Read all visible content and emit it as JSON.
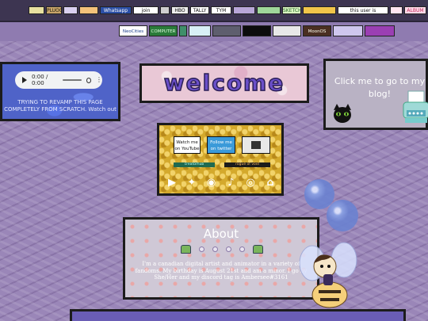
{
  "stamps": [
    {
      "label": "",
      "bg": "#e8e0a0",
      "fg": "#333"
    },
    {
      "label": "PLUOO",
      "bg": "#c9a46a",
      "fg": "#221"
    },
    {
      "label": "",
      "bg": "#d9d0f0",
      "fg": "#333"
    },
    {
      "label": "",
      "bg": "#f4c27a",
      "fg": "#333"
    },
    {
      "label": "Whatsapp",
      "bg": "#2b4fa6",
      "fg": "#fff"
    },
    {
      "label": "join",
      "bg": "#ffffff",
      "fg": "#111"
    },
    {
      "label": "",
      "bg": "#cfcfcf",
      "fg": "#333"
    },
    {
      "label": "HBO",
      "bg": "#eeeeee",
      "fg": "#111"
    },
    {
      "label": "TALLY",
      "bg": "#ffffff",
      "fg": "#111"
    },
    {
      "label": "TYM",
      "bg": "#ffffff",
      "fg": "#111"
    },
    {
      "label": "",
      "bg": "#b8a6d8",
      "fg": "#333"
    },
    {
      "label": "",
      "bg": "#9fd79a",
      "fg": "#333"
    },
    {
      "label": "SKETCHES",
      "bg": "#d8f3c0",
      "fg": "#2a6a2a"
    },
    {
      "label": "",
      "bg": "#f1c54a",
      "fg": "#333"
    },
    {
      "label": "this user is",
      "bg": "#ffffff",
      "fg": "#111"
    },
    {
      "label": "",
      "bg": "#ffe6f0",
      "fg": "#333"
    },
    {
      "label": "ALBUM",
      "bg": "#ffd9e8",
      "fg": "#c03060"
    }
  ],
  "buttons88": [
    {
      "label": "NeoCities",
      "bg": "#ffffff",
      "fg": "#1b3e8a"
    },
    {
      "label": "COMPUTER",
      "bg": "#2a7a3a",
      "fg": "#e0ffe0"
    },
    {
      "label": "",
      "bg": "#3f8f6a",
      "fg": "#fff"
    },
    {
      "label": "",
      "bg": "#d8f0f6",
      "fg": "#136"
    },
    {
      "label": "",
      "bg": "#5e5e6e",
      "fg": "#fff"
    },
    {
      "label": "",
      "bg": "#0c0c0c",
      "fg": "#6f6"
    },
    {
      "label": "",
      "bg": "#e8e8e8",
      "fg": "#333"
    },
    {
      "label": "MoonOS",
      "bg": "#4a2f22",
      "fg": "#ffe"
    },
    {
      "label": "",
      "bg": "#cfc7ee",
      "fg": "#333"
    },
    {
      "label": "",
      "bg": "#9b3fb3",
      "fg": "#fff"
    }
  ],
  "audio": {
    "time": "0:00 / 0:00",
    "note": "TRYING TO REVAMP THIS PAGE COMPLETELY FROM SCRATCH. Watch out"
  },
  "welcome": {
    "text": "welcome"
  },
  "blog": {
    "text": "Click me to go to my blog!"
  },
  "social": {
    "buttons": [
      {
        "label": "Watch me on YouTube"
      },
      {
        "label": "Follow me on twitter"
      },
      {
        "label": ""
      }
    ],
    "strips": [
      {
        "label": "creatorhub"
      },
      {
        "label": "rogue of void"
      }
    ],
    "icons": [
      "youtube-icon",
      "twitter-icon",
      "discord-icon",
      "tiktok-icon",
      "instagram-icon",
      "home-icon"
    ]
  },
  "about": {
    "title": "About",
    "text": "I'm a canadian digital artist and animator in a variety of fandoms. My birthday is August 21st and am a minor. I go by She/Her and my discord tag is Ambersee#3161"
  },
  "colors": {
    "accent_purple": "#6a4fc9",
    "bg": "#9a86b8",
    "gold": "#d4a92c"
  }
}
